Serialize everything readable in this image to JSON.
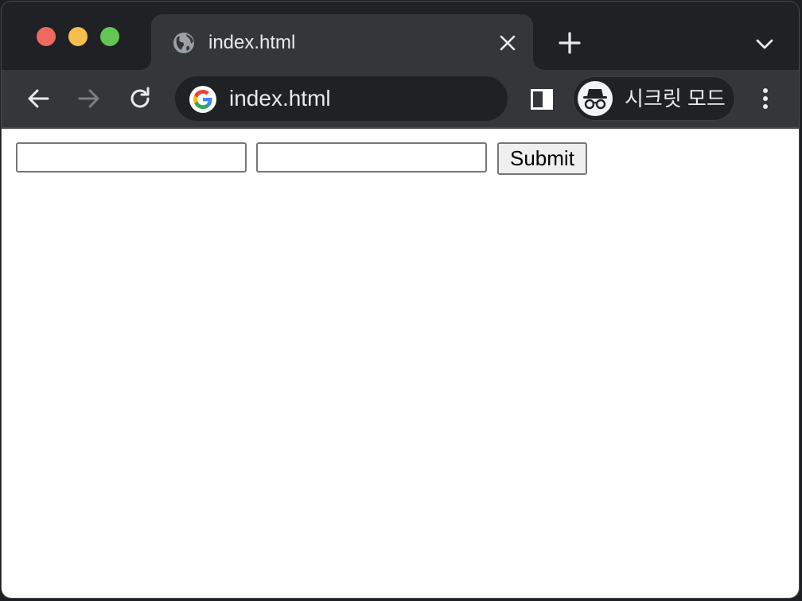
{
  "tab": {
    "title": "index.html",
    "favicon": "globe-icon"
  },
  "omnibox": {
    "text": "index.html",
    "icon": "google-g-icon"
  },
  "profile": {
    "label": "시크릿 모드",
    "icon": "incognito-icon"
  },
  "form": {
    "field1_value": "",
    "field2_value": "",
    "submit_label": "Submit"
  },
  "colors": {
    "tabstrip_bg": "#202124",
    "toolbar_bg": "#35363a",
    "text": "#e8eaed",
    "close": "#ee6a5f",
    "minimize": "#f5be4f",
    "zoom": "#62c554"
  }
}
